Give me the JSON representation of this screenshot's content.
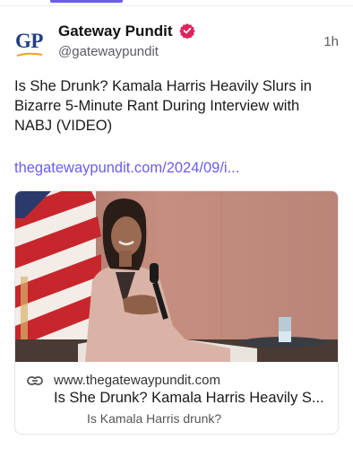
{
  "colors": {
    "accent": "#6a5cf0",
    "verified": "#e0245e",
    "logo_blue": "#1f3f85",
    "logo_orange": "#f0a020"
  },
  "post": {
    "author_name": "Gateway Pundit",
    "author_handle": "@gatewaypundit",
    "avatar_text": "GP",
    "time": "1h",
    "text": "Is She Drunk? Kamala Harris Heavily Slurs in Bizarre 5-Minute Rant During Interview with NABJ (VIDEO)",
    "link": "thegatewaypundit.com/2024/09/i..."
  },
  "icons": {
    "verified": "verified-badge-icon",
    "link": "link-chain-icon"
  },
  "link_card": {
    "domain": "www.thegatewaypundit.com",
    "title": "Is She Drunk? Kamala Harris Heavily S...",
    "description": "Is Kamala Harris drunk?"
  }
}
